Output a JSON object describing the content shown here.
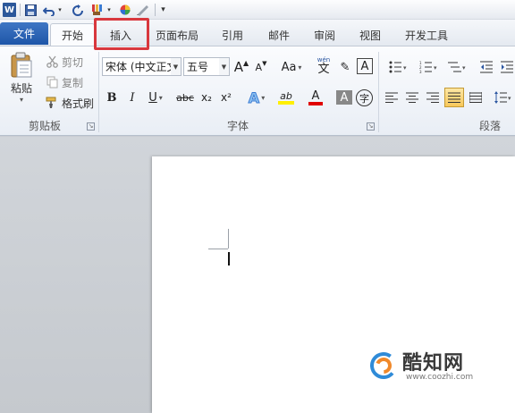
{
  "quick_access": {
    "app_icon": "word-icon",
    "app_letter": "W",
    "items": [
      "save-icon",
      "undo-icon",
      "redo-icon",
      "format-brush-icon",
      "color-wheel-icon",
      "pen-icon",
      "customize-icon"
    ]
  },
  "tabs": [
    {
      "label": "文件"
    },
    {
      "label": "开始"
    },
    {
      "label": "插入"
    },
    {
      "label": "页面布局"
    },
    {
      "label": "引用"
    },
    {
      "label": "邮件"
    },
    {
      "label": "审阅"
    },
    {
      "label": "视图"
    },
    {
      "label": "开发工具"
    }
  ],
  "colors": {
    "accent": "#2b579a",
    "file_tab": "#2a61b3",
    "highlight_box": "#d8373d"
  },
  "clipboard": {
    "paste_label": "粘贴",
    "cut_label": "剪切",
    "copy_label": "复制",
    "format_painter_label": "格式刷",
    "group_label": "剪贴板"
  },
  "font": {
    "font_name": "宋体 (中文正文",
    "font_size": "五号",
    "grow_label": "A",
    "shrink_label": "A",
    "change_case_label": "Aa",
    "bold": "B",
    "italic": "I",
    "underline": "U",
    "strikethrough": "abc",
    "subscript": "x₂",
    "superscript": "x²",
    "phonetic_top": "wén",
    "phonetic_char": "文",
    "char_border": "A",
    "text_effect": "A",
    "highlight": "ab",
    "font_color": "A",
    "shading": "A",
    "enclose": "字",
    "group_label": "字体"
  },
  "paragraph": {
    "group_label": "段落"
  },
  "watermark": {
    "title": "酷知网",
    "url": "www.coozhi.com"
  }
}
